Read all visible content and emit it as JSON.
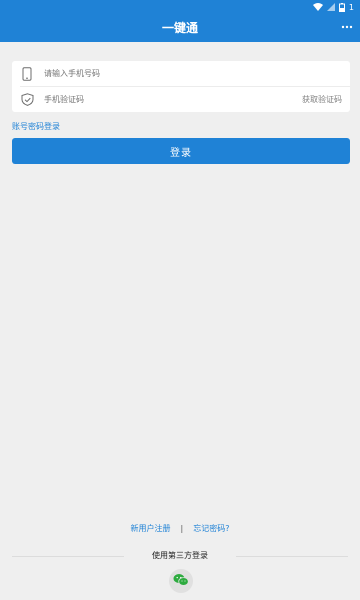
{
  "status_bar": {
    "battery_level": "1",
    "icons": [
      "wifi-icon",
      "signal-icon",
      "battery-icon"
    ]
  },
  "app_bar": {
    "title": "一键通",
    "more_icon": "more-dots-icon"
  },
  "form": {
    "phone_placeholder": "请输入手机号码",
    "phone_icon": "phone-icon",
    "code_placeholder": "手机验证码",
    "code_icon": "shield-icon",
    "get_code_label": "获取验证码"
  },
  "account_login_link": "账号密码登录",
  "login_button": "登录",
  "footer": {
    "register_link": "新用户注册",
    "separator": "|",
    "forgot_link": "忘记密码?",
    "third_party_label": "使用第三方登录",
    "wechat_icon": "wechat-icon"
  },
  "colors": {
    "primary": "#1f82d6",
    "background": "#efefef",
    "card": "#ffffff"
  }
}
